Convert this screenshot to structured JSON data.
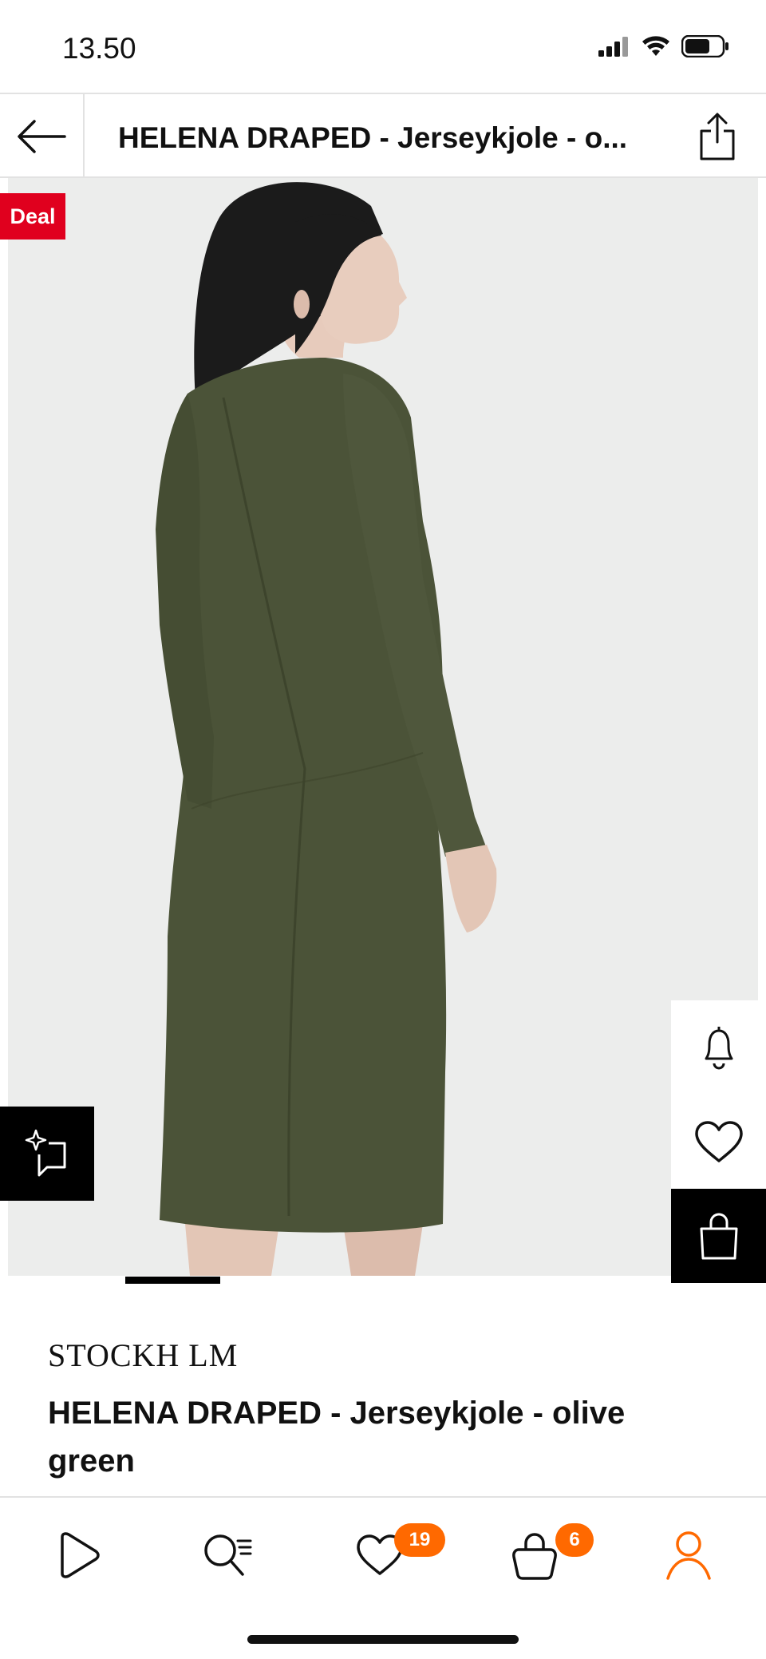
{
  "status_bar": {
    "time": "13.50",
    "icons": [
      "signal-icon",
      "wifi-icon",
      "battery-icon"
    ]
  },
  "top_bar": {
    "title": "HELENA DRAPED - Jerseykjole - o...",
    "icons": [
      "back-arrow-icon",
      "share-icon"
    ]
  },
  "gallery": {
    "badge": "Deal",
    "image": "model-photo",
    "side_actions": [
      "bell-icon",
      "heart-icon",
      "shopping-bag-icon"
    ],
    "similar_icon": "sparkle-similar-icon",
    "progress_fraction": 0.19,
    "colors": {
      "deal_badge": "#e0001e",
      "photo_bg": "#ecedec",
      "dress": "#4b5338"
    }
  },
  "product": {
    "brand": "STOCKH LM",
    "name": "HELENA DRAPED - Jerseykjole - olive green"
  },
  "bottom_nav": {
    "items": [
      {
        "name": "home",
        "icon": "play-home-icon"
      },
      {
        "name": "search",
        "icon": "search-list-icon"
      },
      {
        "name": "wishlist",
        "icon": "heart-icon",
        "badge": "19"
      },
      {
        "name": "bag",
        "icon": "bag-icon",
        "badge": "6"
      },
      {
        "name": "account",
        "icon": "user-icon",
        "active": true
      }
    ],
    "accent": "#ff6900"
  }
}
